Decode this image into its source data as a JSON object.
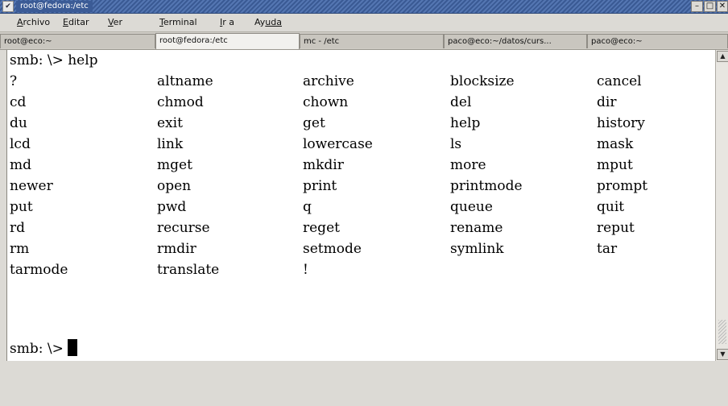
{
  "window": {
    "title": "root@fedora:/etc"
  },
  "menubar": {
    "items": [
      {
        "mnemonic": "A",
        "rest": "rchivo"
      },
      {
        "mnemonic": "E",
        "rest": "ditar"
      },
      {
        "mnemonic": "V",
        "rest": "er"
      },
      {
        "mnemonic": "T",
        "rest": "erminal"
      },
      {
        "mnemonic": "I",
        "rest": "r a"
      },
      {
        "mnemonic": "Ay",
        "rest": "uda"
      }
    ]
  },
  "tabs": [
    {
      "label": "root@eco:~"
    },
    {
      "label": "root@fedora:/etc",
      "active": true
    },
    {
      "label": "mc - /etc"
    },
    {
      "label": "paco@eco:~/datos/curs..."
    },
    {
      "label": "paco@eco:~"
    }
  ],
  "terminal": {
    "prompt_line": "smb: \\> help",
    "rows": [
      [
        "?",
        "altname",
        "archive",
        "blocksize",
        "cancel"
      ],
      [
        "cd",
        "chmod",
        "chown",
        "del",
        "dir"
      ],
      [
        "du",
        "exit",
        "get",
        "help",
        "history"
      ],
      [
        "lcd",
        "link",
        "lowercase",
        "ls",
        "mask"
      ],
      [
        "md",
        "mget",
        "mkdir",
        "more",
        "mput"
      ],
      [
        "newer",
        "open",
        "print",
        "printmode",
        "prompt"
      ],
      [
        "put",
        "pwd",
        "q",
        "queue",
        "quit"
      ],
      [
        "rd",
        "recurse",
        "reget",
        "rename",
        "reput"
      ],
      [
        "rm",
        "rmdir",
        "setmode",
        "symlink",
        "tar"
      ],
      [
        "tarmode",
        "translate",
        "!",
        "",
        ""
      ]
    ],
    "current_prompt": "smb: \\> "
  }
}
